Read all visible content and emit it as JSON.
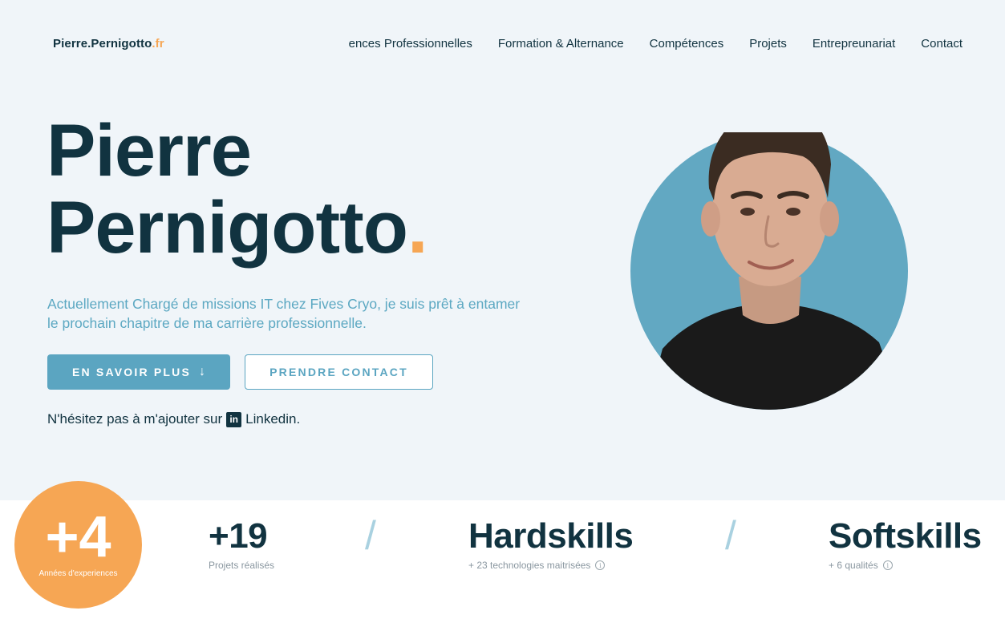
{
  "header": {
    "logo_main": "Pierre.Pernigotto",
    "logo_tld": ".fr",
    "nav": [
      "ences Professionnelles",
      "Formation & Alternance",
      "Compétences",
      "Projets",
      "Entrepreunariat",
      "Contact"
    ]
  },
  "hero": {
    "name_line1": "Pierre",
    "name_line2": "Pernigotto",
    "name_dot": ".",
    "tagline": "Actuellement Chargé de missions IT chez Fives Cryo, je suis prêt à entamer le prochain chapitre de ma carrière professionnelle.",
    "primary_button": "EN SAVOIR PLUS",
    "primary_button_icon": "↓",
    "secondary_button": "PRENDRE CONTACT",
    "linkedin_prefix": "N'hésitez pas à m'ajouter sur",
    "linkedin_icon": "in",
    "linkedin_label": "Linkedin."
  },
  "stats": {
    "badge_value": "+4",
    "badge_label": "Années d'experiences",
    "items": [
      {
        "value": "+19",
        "label": "Projets réalisés"
      },
      {
        "value": "Hardskills",
        "label": "+ 23 technologies maitrisées",
        "info": "i"
      },
      {
        "value": "Softskills",
        "label": "+ 6 qualités",
        "info": "i"
      }
    ],
    "separator": "/"
  },
  "colors": {
    "navy": "#113340",
    "accent_orange": "#f6a654",
    "accent_blue": "#5ba5c1",
    "hero_bg": "#f0f5f9"
  }
}
